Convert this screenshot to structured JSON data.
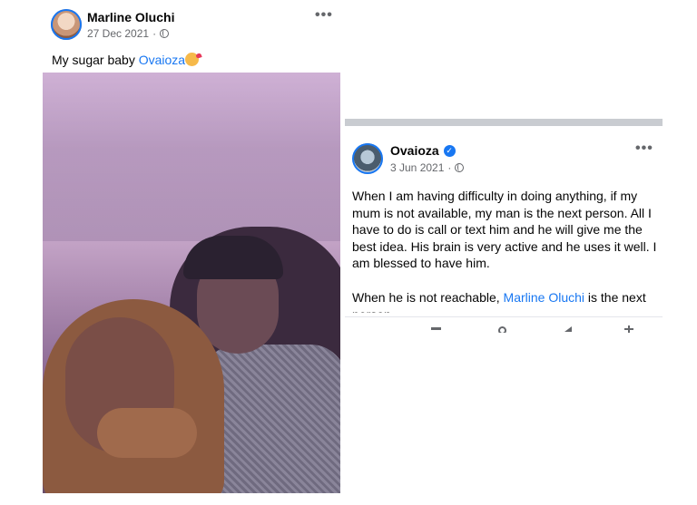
{
  "left_post": {
    "author": "Marline Oluchi",
    "date": "27 Dec 2021",
    "separator": "·",
    "privacy_icon": "globe-icon",
    "more_icon": "more-options-icon",
    "more_label": "•••",
    "caption_text": "My sugar baby ",
    "caption_tag": "Ovaioza",
    "caption_emoji": "smiling-face-with-hearts-emoji"
  },
  "right_post": {
    "author": "Ovaioza",
    "verified_icon": "verified-badge-icon",
    "verified_glyph": "✓",
    "date": "3 Jun 2021",
    "separator": "·",
    "privacy_icon": "globe-icon",
    "more_label": "•••",
    "paragraph_1": "When I am having difficulty in doing anything, if my mum is not available, my man is the next person. All I have to do is call or text him and he will give me the best idea. His brain is very active and he uses it well. I am blessed to have him.",
    "paragraph_2_start": "When he is not reachable, ",
    "paragraph_2_tag": "Marline Oluchi",
    "paragraph_2_end": " is the next person.",
    "nav_icons": [
      "menu-bar-icon",
      "circle-icon",
      "back-triangle-icon",
      "accessibility-icon"
    ]
  },
  "colors": {
    "link": "#1877f2",
    "secondary_text": "#65676b",
    "divider": "#c9ccd1"
  }
}
